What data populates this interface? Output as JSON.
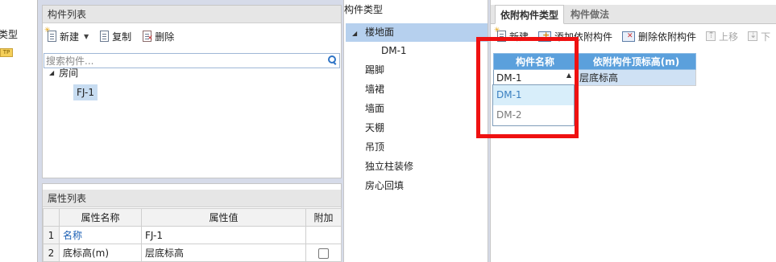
{
  "left_strip": {
    "stub_text": "类型",
    "badge_text": "TP"
  },
  "component_list": {
    "title": "构件列表",
    "toolbar": {
      "new_label": "新建",
      "copy_label": "复制",
      "delete_label": "删除"
    },
    "search": {
      "placeholder": "搜索构件..."
    },
    "tree": {
      "parent": "房间",
      "child": "FJ-1"
    }
  },
  "property_list": {
    "title": "属性列表",
    "headers": [
      "属性名称",
      "属性值",
      "附加"
    ],
    "rows": [
      {
        "num": "1",
        "name": "名称",
        "value": "FJ-1"
      },
      {
        "num": "2",
        "name": "底标高(m)",
        "value": "层底标高"
      }
    ]
  },
  "component_types": {
    "title": "构件类型",
    "items": [
      "楼地面",
      "DM-1",
      "踢脚",
      "墙裙",
      "墙面",
      "天棚",
      "吊顶",
      "独立柱装修",
      "房心回填"
    ]
  },
  "right_panel": {
    "tabs": [
      "依附构件类型",
      "构件做法"
    ],
    "toolbar": {
      "new_label": "新建",
      "add_label": "添加依附构件",
      "delete_label": "删除依附构件",
      "up_label": "上移",
      "down_label": "下"
    },
    "table": {
      "headers": [
        "构件名称",
        "依附构件顶标高(m)"
      ],
      "selected_value": "DM-1",
      "height_value": "层底标高"
    },
    "dropdown_options": [
      "DM-1",
      "DM-2"
    ]
  },
  "colors": {
    "highlight_box": "#ef1111",
    "header_blue": "#5ba0dc",
    "selection": "#c7dcf1"
  }
}
